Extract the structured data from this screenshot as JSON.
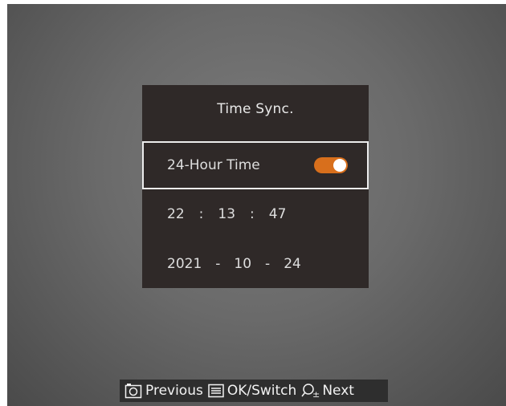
{
  "panel": {
    "title": "Time Sync.",
    "hour_mode_label": "24-Hour Time",
    "hour_mode_enabled": true,
    "time": {
      "hour": "22",
      "minute": "13",
      "second": "47",
      "separator": ":"
    },
    "date": {
      "year": "2021",
      "month": "10",
      "day": "24",
      "separator": "-"
    }
  },
  "bottom_bar": {
    "previous_label": "Previous",
    "ok_label": "OK/Switch",
    "next_label": "Next",
    "zoom_symbol": "±"
  },
  "icons": {
    "previous": "camera-icon",
    "ok": "menu-icon",
    "next": "zoom-icon"
  },
  "colors": {
    "toggle_on": "#d86f1c",
    "panel_bg": "#2f2928",
    "selection_border": "#ececec"
  }
}
